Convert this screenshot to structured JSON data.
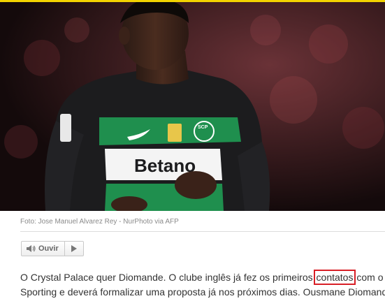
{
  "photo": {
    "jersey_sponsor": "Betano",
    "jersey_crest_text": "SCP",
    "alt": "Ousmane Diomande"
  },
  "caption": "Foto: Jose Manuel Alvarez Rey - NurPhoto via AFP",
  "listen": {
    "label": "Ouvir",
    "icon": "speaker-icon",
    "play_icon": "play-icon"
  },
  "article": {
    "line1_before": "O Crystal Palace quer Diomande. O clube inglês já fez os primeiros",
    "line1_highlight": "contatos",
    "line1_after": "com o",
    "line2": "Sporting e deverá formalizar uma proposta já nos próximos dias. Ousmane Diomande"
  },
  "colors": {
    "accent_bar": "#f2d300",
    "highlight_border": "#d81f26",
    "jersey_green": "#1f8f4e",
    "jersey_black": "#1c1c1e"
  }
}
